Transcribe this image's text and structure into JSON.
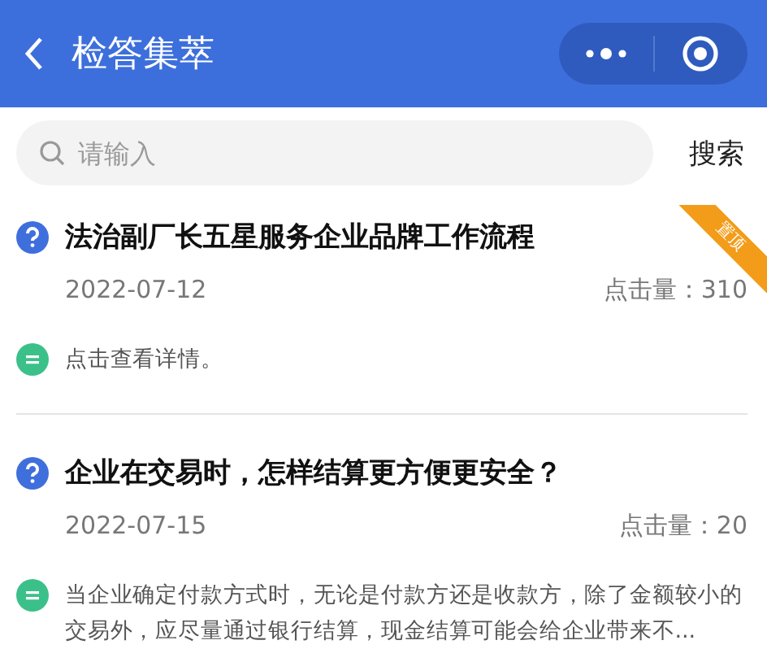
{
  "header": {
    "title": "检答集萃"
  },
  "search": {
    "placeholder": "请输入",
    "button": "搜索"
  },
  "items": [
    {
      "title": "法治副厂长五星服务企业品牌工作流程",
      "date": "2022-07-12",
      "views": "点击量：310",
      "ribbon": "置顶",
      "answer": "点击查看详情。"
    },
    {
      "title": "企业在交易时，怎样结算更方便更安全？",
      "date": "2022-07-15",
      "views": "点击量：20",
      "answer": "当企业确定付款方式时，无论是付款方还是收款方，除了金额较小的交易外，应尽量通过银行结算，现金结算可能会给企业带来不..."
    }
  ]
}
